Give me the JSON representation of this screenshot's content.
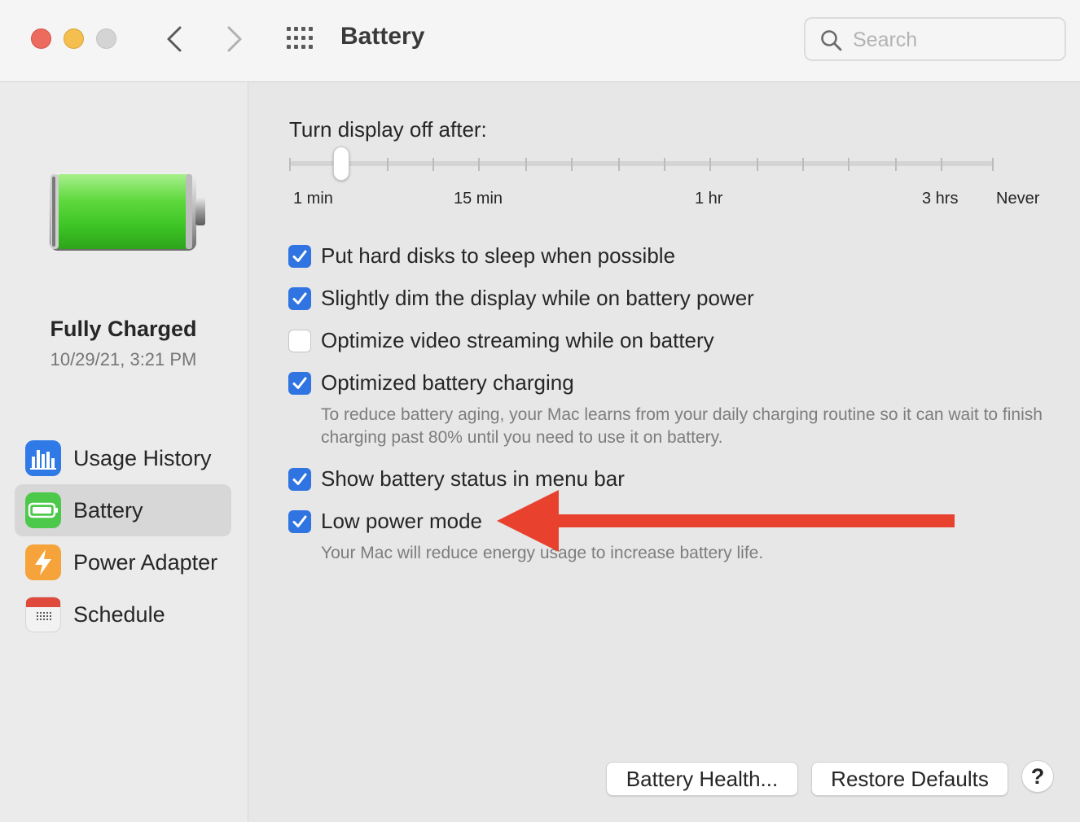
{
  "window": {
    "title": "Battery",
    "search_placeholder": "Search"
  },
  "sidebar": {
    "status_title": "Fully Charged",
    "status_time": "10/29/21, 3:21 PM",
    "items": [
      {
        "label": "Usage History",
        "icon": "bar-chart-icon",
        "selected": false
      },
      {
        "label": "Battery",
        "icon": "battery-icon",
        "selected": true
      },
      {
        "label": "Power Adapter",
        "icon": "lightning-icon",
        "selected": false
      },
      {
        "label": "Schedule",
        "icon": "calendar-icon",
        "selected": false
      }
    ]
  },
  "display_slider": {
    "label": "Turn display off after:",
    "tick_labels": [
      "1 min",
      "15 min",
      "1 hr",
      "3 hrs",
      "Never"
    ],
    "selected_step": 2
  },
  "options": [
    {
      "label": "Put hard disks to sleep when possible",
      "checked": true
    },
    {
      "label": "Slightly dim the display while on battery power",
      "checked": true
    },
    {
      "label": "Optimize video streaming while on battery",
      "checked": false
    },
    {
      "label": "Optimized battery charging",
      "checked": true,
      "description": "To reduce battery aging, your Mac learns from your daily charging routine so it can wait to finish charging past 80% until you need to use it on battery."
    },
    {
      "label": "Show battery status in menu bar",
      "checked": true
    },
    {
      "label": "Low power mode",
      "checked": true,
      "description": "Your Mac will reduce energy usage to increase battery life."
    }
  ],
  "buttons": {
    "battery_health": "Battery Health...",
    "restore_defaults": "Restore Defaults",
    "help": "?"
  },
  "colors": {
    "accent": "#2f74e0",
    "annotation_arrow": "#e8412e",
    "battery_fill": "#4cd137"
  }
}
